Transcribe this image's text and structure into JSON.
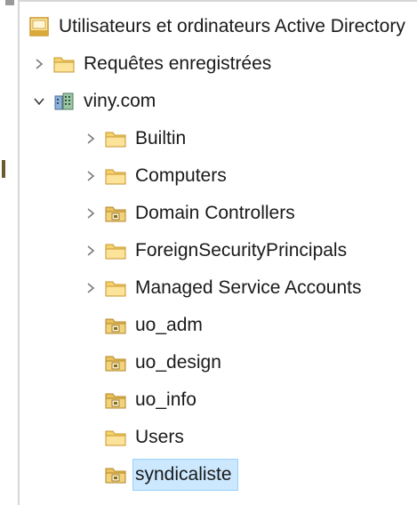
{
  "tree": {
    "root": {
      "label": "Utilisateurs et ordinateurs Active Directory",
      "icon": "ad-console-icon"
    },
    "saved_queries": {
      "label": "Requêtes enregistrées",
      "icon": "folder-icon",
      "expander": "chevron-right-icon"
    },
    "domain": {
      "label": "viny.com",
      "icon": "domain-icon",
      "expander": "chevron-down-icon"
    },
    "children": [
      {
        "label": "Builtin",
        "icon": "folder-icon",
        "expander": "chevron-right-icon"
      },
      {
        "label": "Computers",
        "icon": "folder-icon",
        "expander": "chevron-right-icon"
      },
      {
        "label": "Domain Controllers",
        "icon": "ou-icon",
        "expander": "chevron-right-icon"
      },
      {
        "label": "ForeignSecurityPrincipals",
        "icon": "folder-icon",
        "expander": "chevron-right-icon"
      },
      {
        "label": "Managed Service Accounts",
        "icon": "folder-icon",
        "expander": "chevron-right-icon"
      },
      {
        "label": "uo_adm",
        "icon": "ou-icon",
        "expander": ""
      },
      {
        "label": "uo_design",
        "icon": "ou-icon",
        "expander": ""
      },
      {
        "label": "uo_info",
        "icon": "ou-icon",
        "expander": ""
      },
      {
        "label": "Users",
        "icon": "folder-icon",
        "expander": ""
      },
      {
        "label": "syndicaliste",
        "icon": "ou-icon",
        "expander": "",
        "selected": true
      }
    ]
  },
  "colors": {
    "selection_bg": "#cce8ff",
    "selection_border": "#99d1ff",
    "folder_yellow": "#f4d36b",
    "folder_dark": "#d9a93a",
    "chevron": "#7a7a7a"
  }
}
